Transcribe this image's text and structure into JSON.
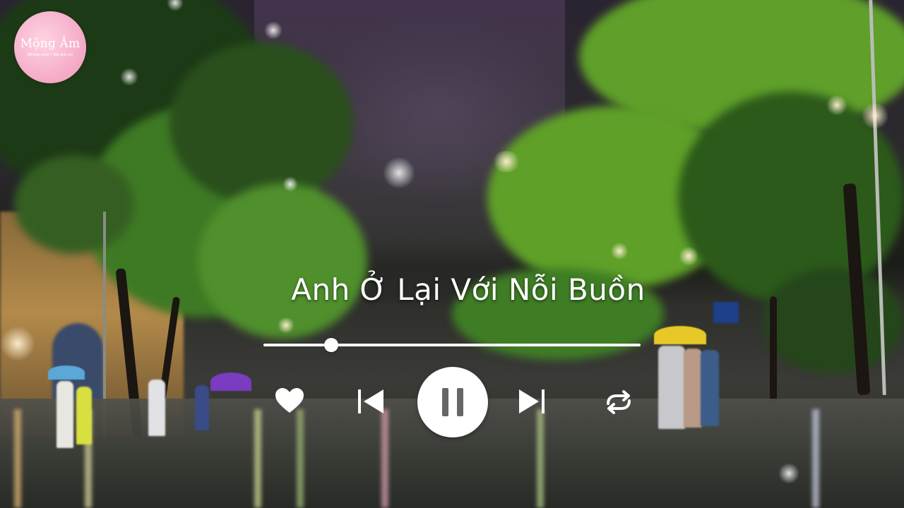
{
  "logo": {
    "title": "Mộng Âm",
    "subtitle": "Mỗi bản cover – Một giấc mơ"
  },
  "player": {
    "song_title": "Anh Ở Lại Với Nỗi Buồn",
    "progress_fraction": 0.18,
    "is_playing": true
  },
  "icons": {
    "like": "heart-icon",
    "previous": "skip-previous-icon",
    "play_pause": "pause-icon",
    "next": "skip-next-icon",
    "repeat": "repeat-icon"
  },
  "colors": {
    "control": "#ffffff",
    "pause_glyph": "#666666",
    "logo_bg": "#f4a9c6"
  }
}
